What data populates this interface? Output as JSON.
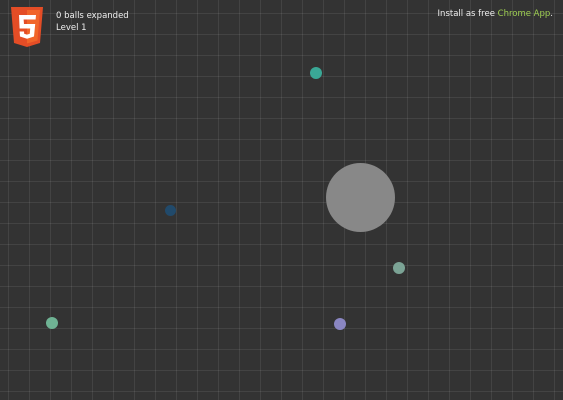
{
  "hud": {
    "expanded_text": "0 balls expanded",
    "level_text": "Level 1"
  },
  "install": {
    "prefix": "Install as free ",
    "link_text": "Chrome App",
    "suffix": "."
  },
  "colors": {
    "background": "#333333",
    "link": "#9fcf52",
    "logo_orange": "#e44d26",
    "logo_orange_light": "#f16529"
  },
  "balls": [
    {
      "color": "#3aa896"
    },
    {
      "color": "#214a6b"
    },
    {
      "color": "#888888"
    },
    {
      "color": "#7ba395"
    },
    {
      "color": "#6fb394"
    },
    {
      "color": "#8a86c2"
    }
  ]
}
